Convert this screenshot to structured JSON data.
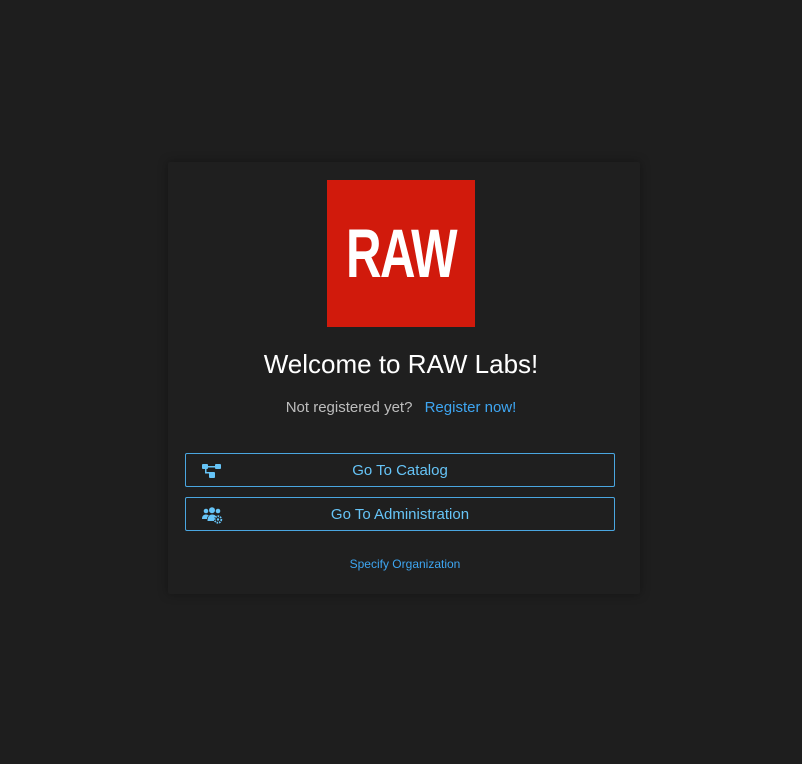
{
  "logo": {
    "text": "RAW",
    "background_color": "#d11a0c"
  },
  "welcome": {
    "title": "Welcome to RAW Labs!"
  },
  "register": {
    "prompt": "Not registered yet?",
    "link_label": "Register now!"
  },
  "buttons": {
    "catalog": {
      "label": "Go To Catalog",
      "icon": "sitemap-icon"
    },
    "administration": {
      "label": "Go To Administration",
      "icon": "users-cog-icon"
    }
  },
  "organization": {
    "link_label": "Specify Organization"
  },
  "colors": {
    "background": "#1e1e1e",
    "accent": "#3ea6f2",
    "button_text": "#66c4f7",
    "button_border": "#4aa6e0"
  }
}
